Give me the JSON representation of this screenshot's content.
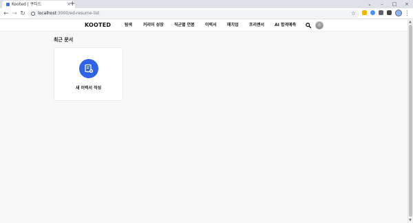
{
  "browser": {
    "tab_title": "Kooted | 쿠티드",
    "tab_close": "×",
    "new_tab": "+",
    "url_host": "localhost",
    "url_path": ":3000/ed-resume-list",
    "window_controls": {
      "minimize": "–",
      "maximize": "□",
      "close": "×",
      "tabs_menu": "⌄"
    },
    "nav": {
      "back": "←",
      "forward": "→",
      "reload": "↻"
    },
    "star": "☆",
    "menu": "⋮"
  },
  "header": {
    "logo": "KOOTED",
    "nav_items": [
      "탐색",
      "커리어 성장",
      "직군별 연봉",
      "이력서",
      "매치업",
      "프리랜서",
      "AI 합격예측"
    ]
  },
  "main": {
    "section_title": "최근 문서",
    "new_resume_card": {
      "label": "새 이력서 작성",
      "icon": "new-document-icon"
    }
  },
  "colors": {
    "accent": "#2f64e8",
    "page_bg": "#f8f8f8",
    "header_bg": "#ffffff"
  }
}
